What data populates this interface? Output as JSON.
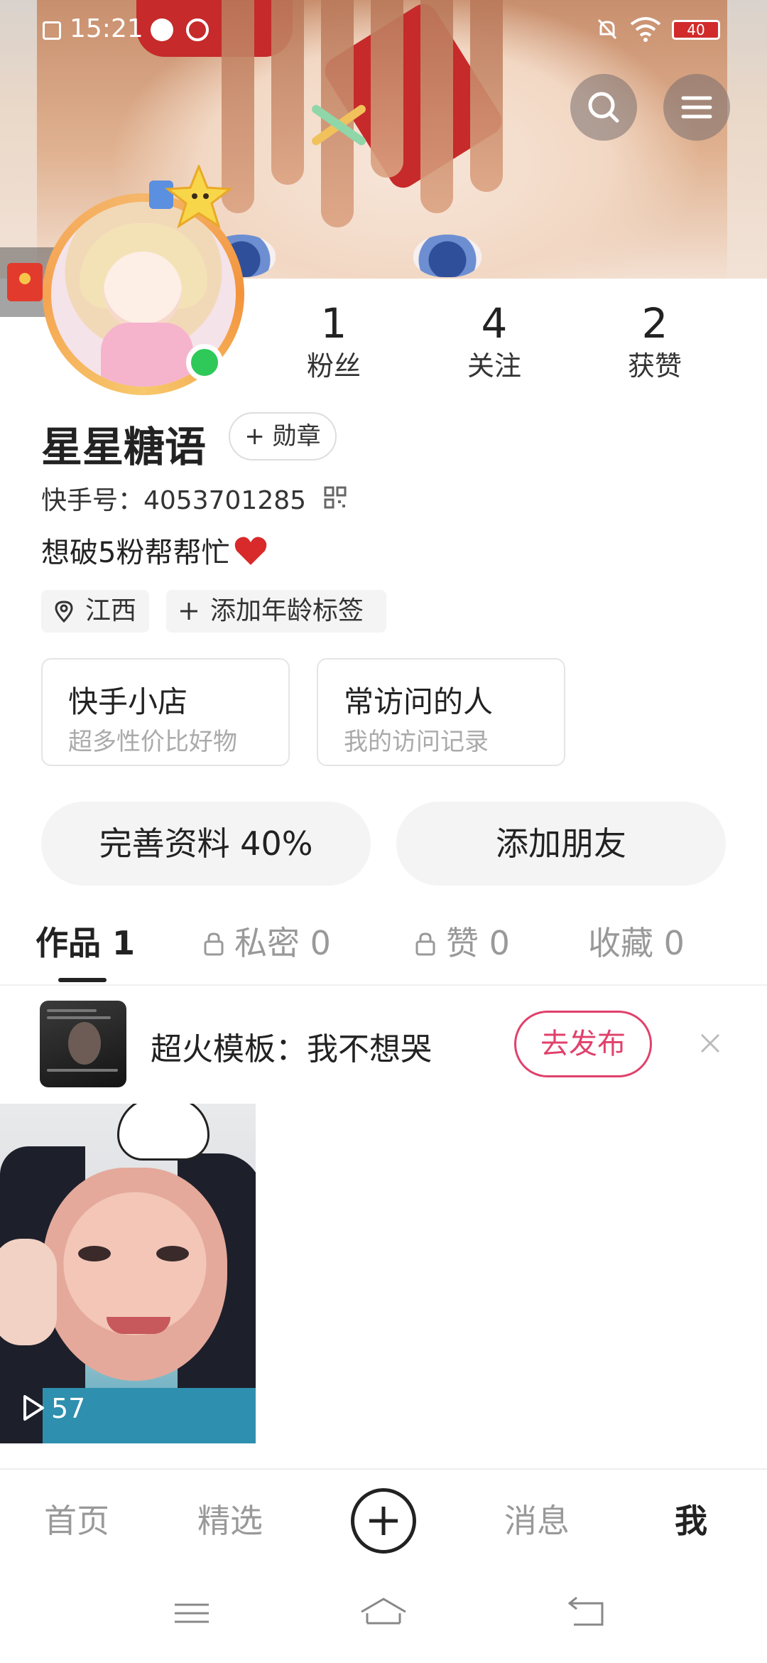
{
  "status_bar": {
    "time": "15:21",
    "battery": "40"
  },
  "profile": {
    "name": "星星糖语",
    "badge_button": "+ 勋章",
    "kuaishou_id": "快手号：4053701285",
    "bio": "想破5粉帮帮忙"
  },
  "stats": [
    {
      "value": "1",
      "label": "粉丝"
    },
    {
      "value": "4",
      "label": "关注"
    },
    {
      "value": "2",
      "label": "获赞"
    }
  ],
  "chips": {
    "location": "江西",
    "age_tag": "添加年龄标签"
  },
  "cards": [
    {
      "title": "快手小店",
      "subtitle": "超多性价比好物"
    },
    {
      "title": "常访问的人",
      "subtitle": "我的访问记录"
    }
  ],
  "actions": {
    "complete_profile": "完善资料 40%",
    "add_friends": "添加朋友"
  },
  "tabs": [
    {
      "label": "作品 1"
    },
    {
      "label": "私密 0"
    },
    {
      "label": "赞 0"
    },
    {
      "label": "收藏 0"
    }
  ],
  "template_prompt": {
    "text": "超火模板：我不想哭",
    "button": "去发布"
  },
  "video": {
    "play_count": "57"
  },
  "bottom_nav": [
    "首页",
    "精选",
    "消息",
    "我"
  ],
  "colors": {
    "accent": "#e0416b",
    "online": "#2fc95a"
  }
}
